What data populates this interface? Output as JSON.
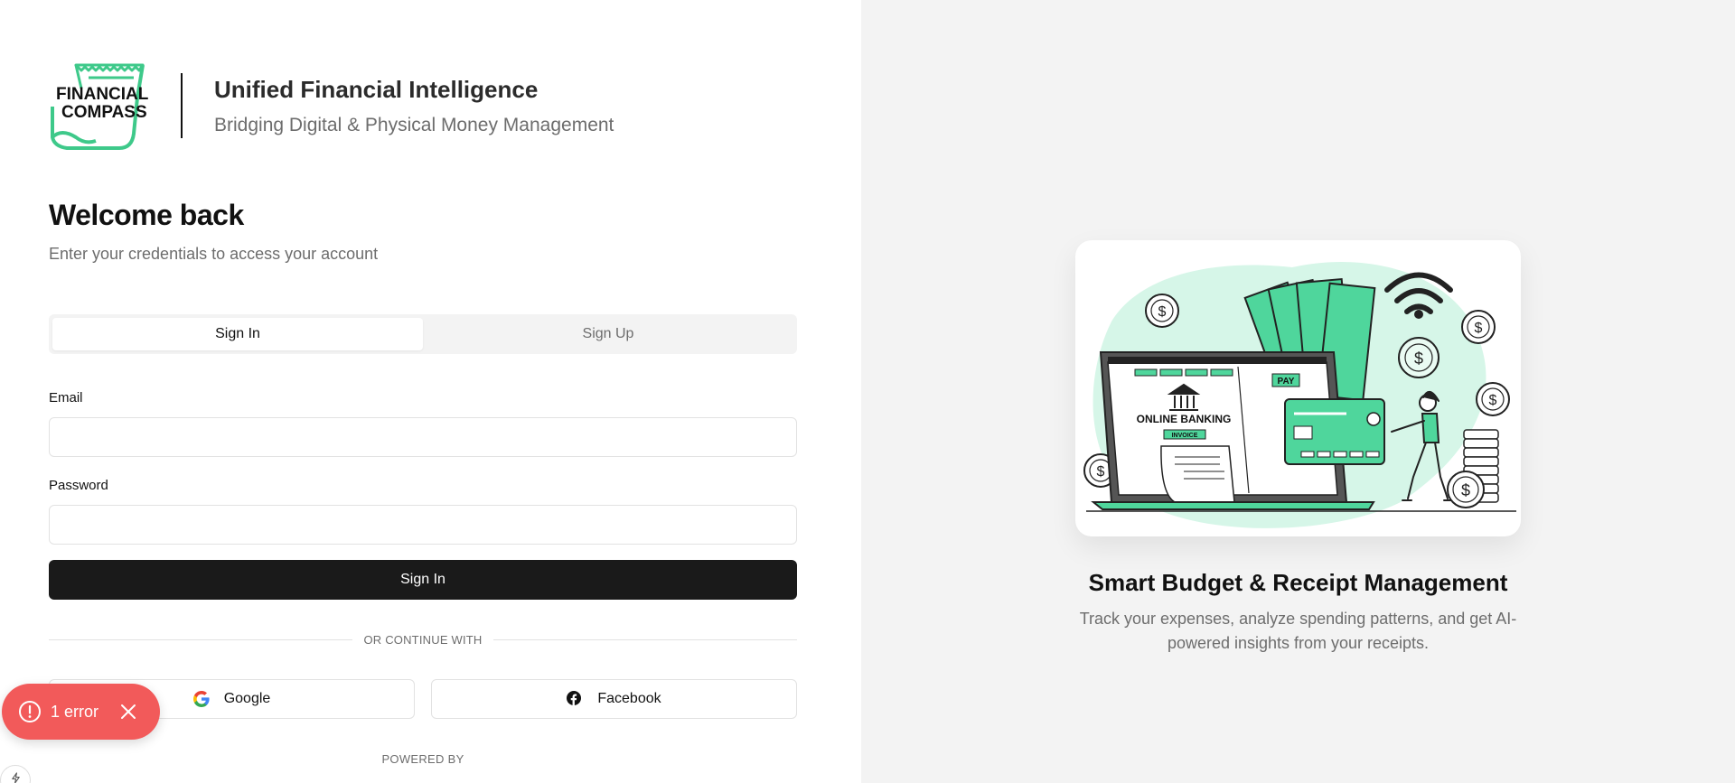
{
  "brand": {
    "logo_text_line1": "FINANCIAL",
    "logo_text_line2": "COMPASS",
    "title": "Unified Financial Intelligence",
    "subtitle": "Bridging Digital & Physical Money Management"
  },
  "auth": {
    "heading": "Welcome back",
    "subheading": "Enter your credentials to access your account",
    "tabs": [
      {
        "label": "Sign In",
        "active": true
      },
      {
        "label": "Sign Up",
        "active": false
      }
    ],
    "email_label": "Email",
    "email_value": "",
    "password_label": "Password",
    "password_value": "",
    "submit_label": "Sign In",
    "divider_text": "OR CONTINUE WITH",
    "social": [
      {
        "label": "Google",
        "icon": "google-icon"
      },
      {
        "label": "Facebook",
        "icon": "facebook-icon"
      }
    ],
    "powered_by": "POWERED BY"
  },
  "toast": {
    "text": "1 error",
    "icon": "alert-circle-icon",
    "color": "#f25a5a"
  },
  "illustration": {
    "label_online_banking": "ONLINE BANKING",
    "label_invoice": "INVOICE",
    "label_pay": "PAY",
    "accent": "#4fd69c"
  },
  "hero": {
    "title": "Smart Budget & Receipt Management",
    "description": "Track your expenses, analyze spending patterns, and get AI-powered insights from your receipts."
  },
  "colors": {
    "primary_button": "#1a1a1a",
    "muted_text": "#6d6d6d",
    "panel_bg": "#f3f3f3",
    "brand_green": "#3ec98a"
  }
}
